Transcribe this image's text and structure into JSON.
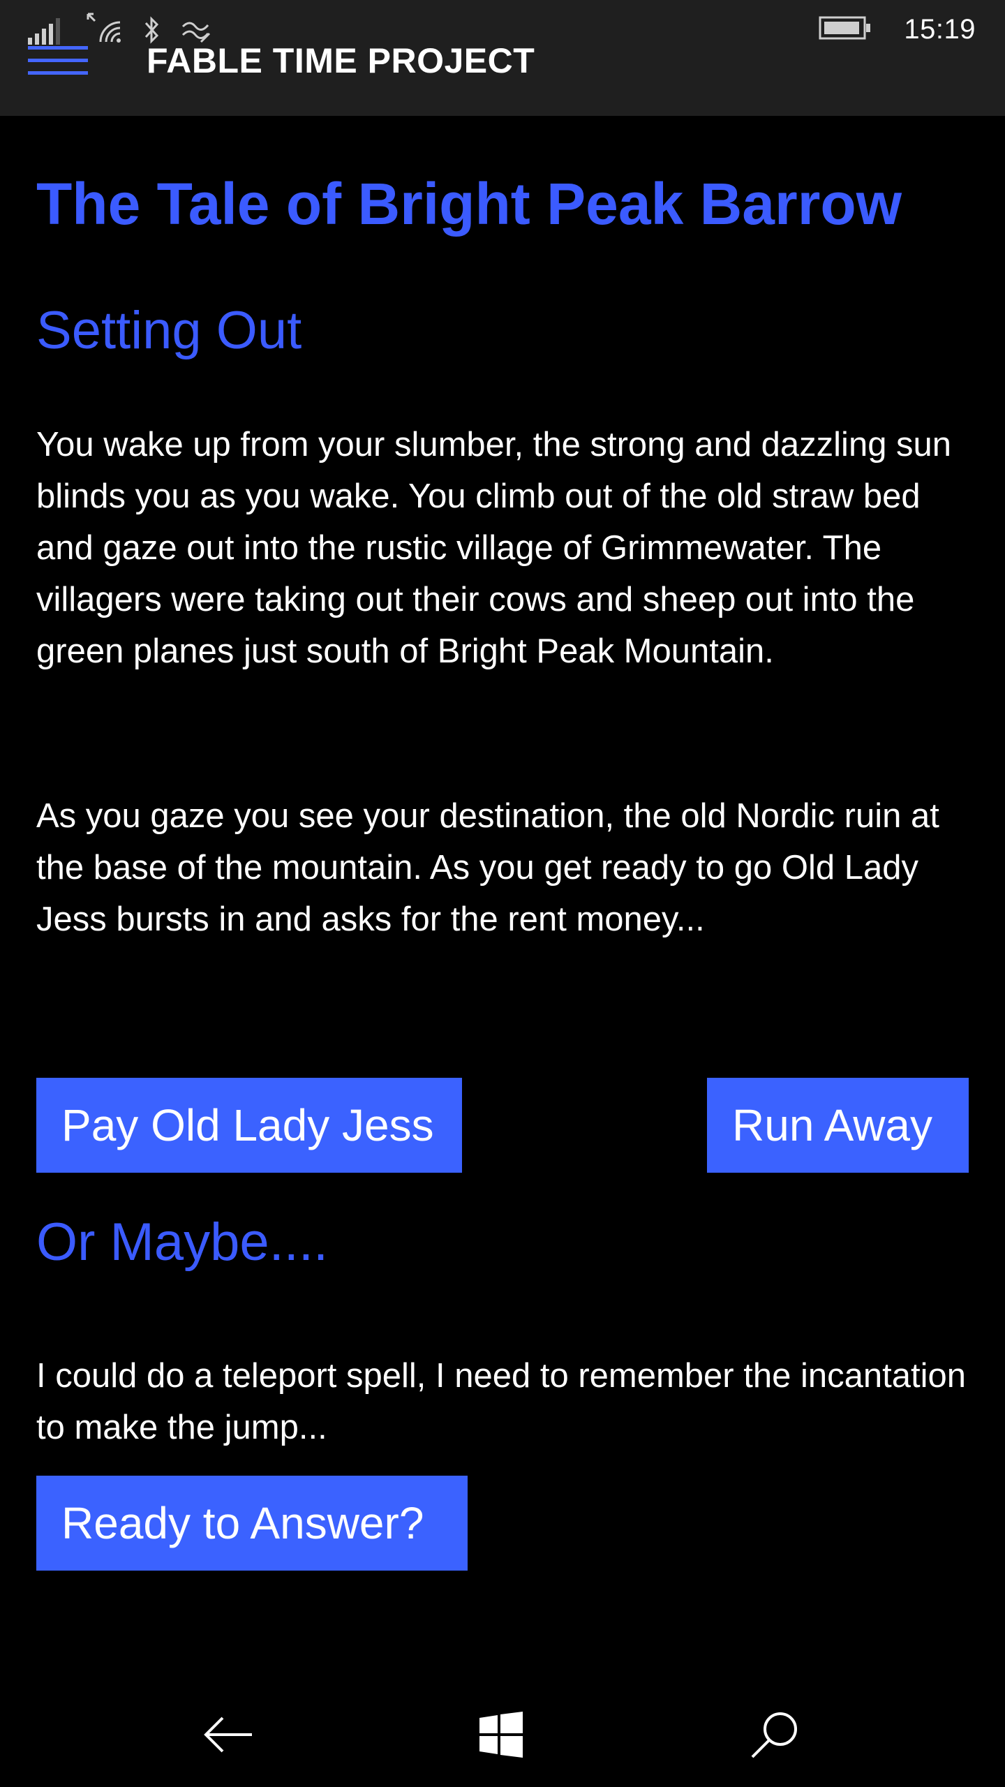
{
  "status_bar": {
    "time": "15:19",
    "icons": [
      "signal-icon",
      "wifi-icon",
      "bluetooth-icon",
      "data-sense-icon",
      "battery-icon"
    ]
  },
  "header": {
    "app_title": "FABLE TIME PROJECT",
    "menu_icon": "hamburger-menu-icon",
    "accent_color": "#3b5bff"
  },
  "story": {
    "title": "The Tale of Bright Peak Barrow",
    "section1": {
      "heading": "Setting Out",
      "paragraphs": [
        "You wake up from your slumber, the strong and dazzling sun blinds you as you wake. You climb out of the old straw bed and gaze out into the rustic village of Grimmewater. The villagers were taking out their cows and sheep out into the green planes just south of Bright Peak Mountain.",
        "As you gaze you see your destination, the old Nordic ruin at the base of the mountain. As you get ready to go Old Lady Jess bursts in and asks for the rent money..."
      ],
      "choices": {
        "pay": "Pay Old Lady Jess",
        "run": "Run Away"
      }
    },
    "section2": {
      "heading": "Or Maybe....",
      "paragraph": "I could do a teleport spell, I need to remember the incantation to make the jump...",
      "button": "Ready to Answer?"
    }
  },
  "nav_bar": {
    "icons": [
      "back-arrow-icon",
      "windows-logo-icon",
      "search-icon"
    ]
  }
}
